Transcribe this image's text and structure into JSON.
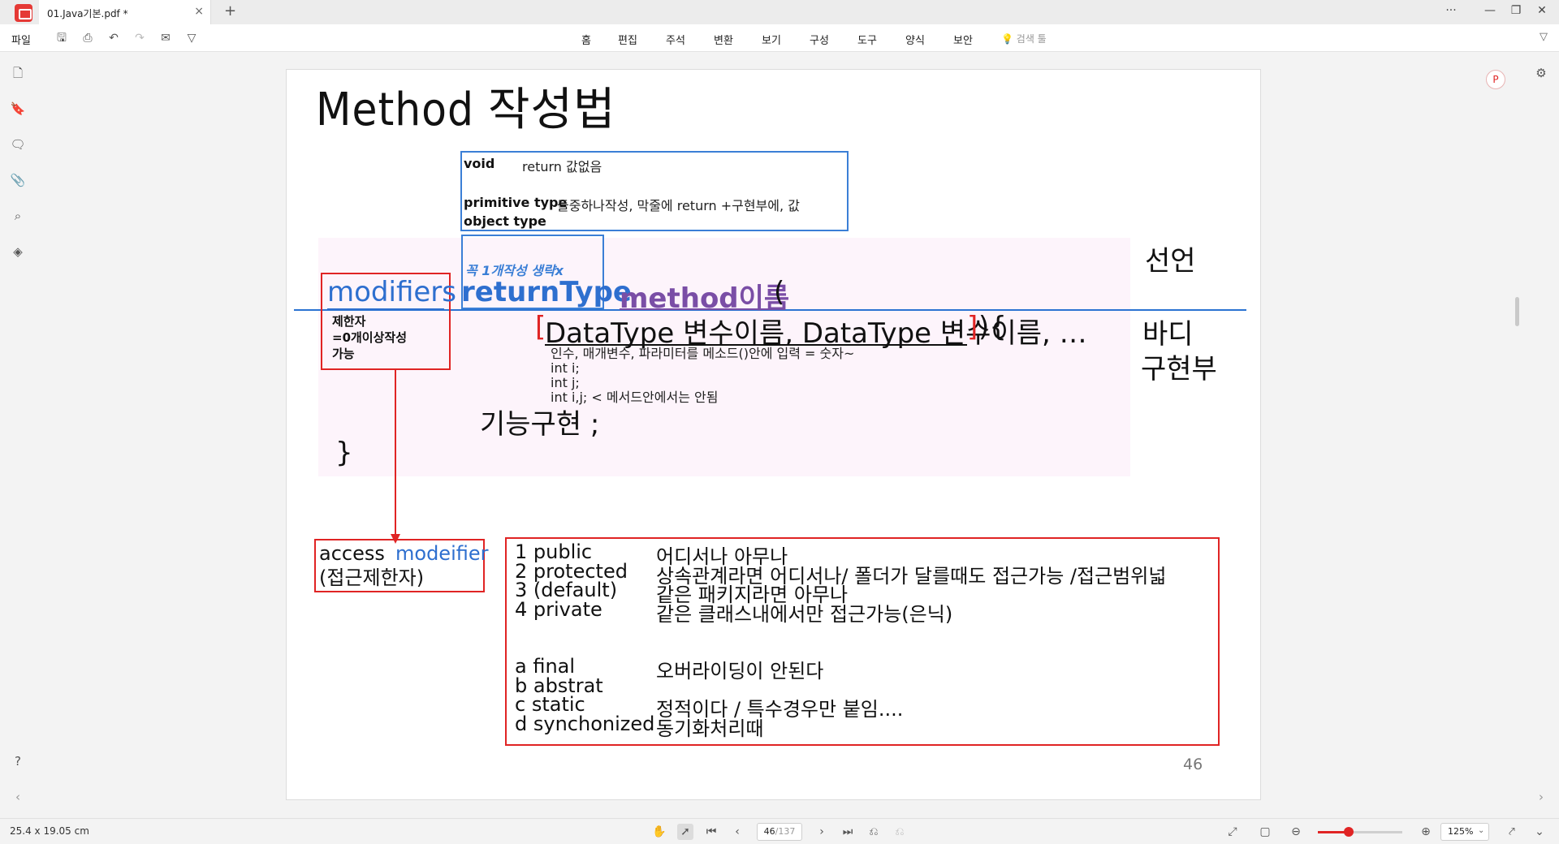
{
  "app": {
    "tab_title": "01.Java기본.pdf *",
    "tab_close": "×",
    "tab_add": "+",
    "window": {
      "more": "···",
      "minimize": "—",
      "restore": "❐",
      "close": "✕"
    }
  },
  "toolbar": {
    "file": "파일",
    "menu": [
      "홈",
      "편집",
      "주석",
      "변환",
      "보기",
      "구성",
      "도구",
      "양식",
      "보안"
    ],
    "search": "검색 툴"
  },
  "page": {
    "title": "Method  작성법",
    "return_types": {
      "void_label": "void",
      "void_desc": "return 값없음",
      "primitive_label": "primitive type",
      "primitive_desc": "둘중하나작성, 막줄에 return +구현부에, 값",
      "object_label": "object type"
    },
    "return_note": "꼭 1개작성 생략x",
    "return_type": "returnType",
    "modifiers": "modifiers",
    "modifiers_note": "제한자\n=0개이상작성\n가능",
    "method_name": "method이름",
    "open_paren": "(",
    "bracket_open": "[",
    "params": "DataType 변수이름, DataType 변수이름, …",
    "bracket_close": "]",
    "params_end": " ){",
    "param_desc": "인수, 매개변수, 파라미터를 메소드()안에 입력 = 숫자~\nint i;\nint j;\nint i,j; < 메서드안에서는 안됨",
    "body_impl": "기능구현 ;",
    "close_brace": "}",
    "side_declaration": "선언",
    "side_body": "바디",
    "side_impl": "구현부",
    "access_label": "access",
    "access_modifier": "modeifier",
    "access_paren": "(접근제한자)",
    "modifier_list": [
      {
        "name": "1 public",
        "desc": "어디서나 아무나"
      },
      {
        "name": "2 protected",
        "desc": "상속관계라면 어디서나/ 폴더가 달를때도 접근가능 /접근범위넓"
      },
      {
        "name": "3 (default)",
        "desc": "같은 패키지라면 아무나"
      },
      {
        "name": "4 private",
        "desc": "같은 클래스내에서만 접근가능(은닉)"
      },
      {
        "name": "a final",
        "desc": "오버라이딩이 안된다"
      },
      {
        "name": "b abstrat",
        "desc": ""
      },
      {
        "name": "c static",
        "desc": "정적이다 / 특수경우만 붙임...."
      },
      {
        "name": "d synchonized",
        "desc": "동기화처리때"
      }
    ],
    "page_number": "46"
  },
  "statusbar": {
    "dimensions": "25.4 x 19.05 cm",
    "current_page": "46",
    "total_pages": "/137",
    "zoom": "125%",
    "zoom_level": 0.37
  },
  "colors": {
    "accent": "#e02424",
    "blue": "#2e6fcf",
    "purple": "#7a4ea6"
  }
}
